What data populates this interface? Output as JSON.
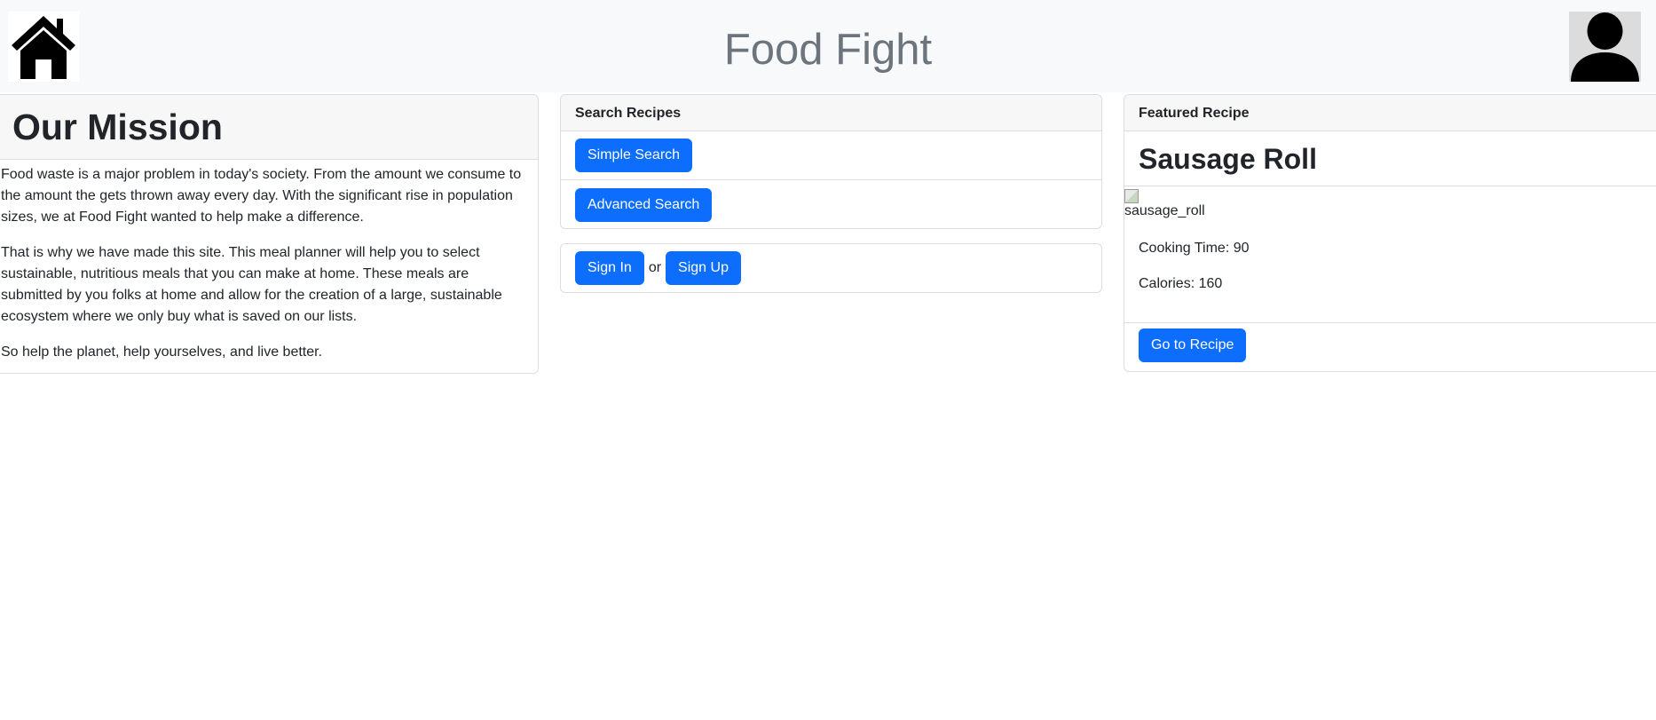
{
  "navbar": {
    "home_icon": "house-icon",
    "brand": "Food Fight",
    "profile_icon": "user-avatar-icon",
    "background": "#f8f9fa",
    "brand_color": "#6c757d"
  },
  "mission": {
    "title": "Our Mission",
    "paragraphs": [
      "Food waste is a major problem in today's society. From the amount we consume to the amount the gets thrown away every day. With the significant rise in population sizes, we at Food Fight wanted to help make a difference.",
      "That is why we have made this site. This meal planner will help you to select sustainable, nutritious meals that you can make at home. These meals are submitted by you folks at home and allow for the creation of a large, sustainable ecosystem where we only buy what is saved on our lists.",
      "So help the planet, help yourselves, and live better."
    ]
  },
  "search": {
    "header": "Search Recipes",
    "simple_label": "Simple Search",
    "advanced_label": "Advanced Search"
  },
  "auth": {
    "sign_in_label": "Sign In",
    "or_text": "or",
    "sign_up_label": "Sign Up"
  },
  "featured": {
    "header": "Featured Recipe",
    "recipe_name": "Sausage Roll",
    "image_alt": "sausage_roll",
    "cooking_time": "Cooking Time: 90",
    "calories": "Calories: 160",
    "go_label": "Go to Recipe"
  },
  "colors": {
    "primary_button": "#0d6efd",
    "card_border": "#dcdde0",
    "card_header_bg": "#f7f7f7"
  }
}
